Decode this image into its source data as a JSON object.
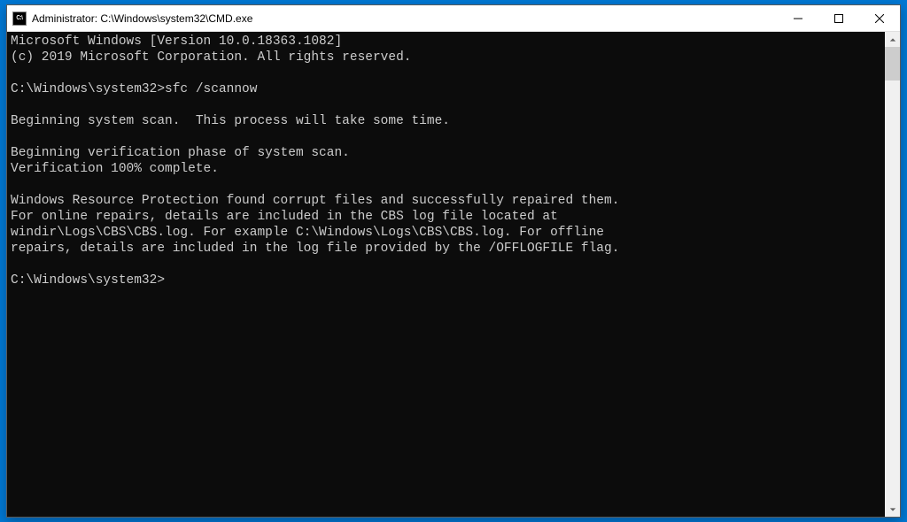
{
  "window": {
    "title": "Administrator: C:\\Windows\\system32\\CMD.exe",
    "icon_label": "C:\\"
  },
  "terminal": {
    "lines": [
      "Microsoft Windows [Version 10.0.18363.1082]",
      "(c) 2019 Microsoft Corporation. All rights reserved.",
      "",
      "C:\\Windows\\system32>sfc /scannow",
      "",
      "Beginning system scan.  This process will take some time.",
      "",
      "Beginning verification phase of system scan.",
      "Verification 100% complete.",
      "",
      "Windows Resource Protection found corrupt files and successfully repaired them.",
      "For online repairs, details are included in the CBS log file located at",
      "windir\\Logs\\CBS\\CBS.log. For example C:\\Windows\\Logs\\CBS\\CBS.log. For offline",
      "repairs, details are included in the log file provided by the /OFFLOGFILE flag.",
      "",
      "C:\\Windows\\system32>"
    ]
  }
}
